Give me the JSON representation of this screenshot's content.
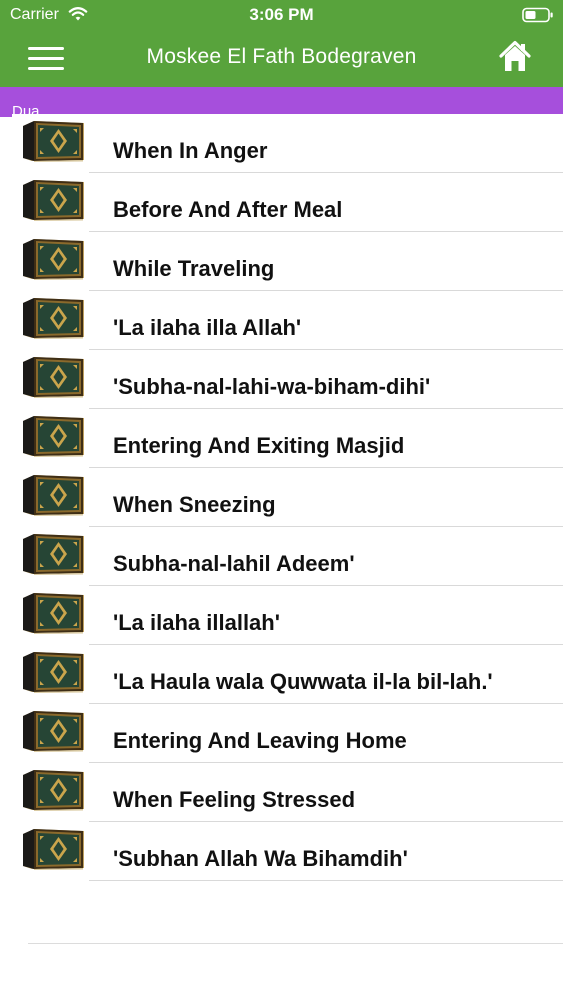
{
  "status_bar": {
    "carrier": "Carrier",
    "time": "3:06 PM"
  },
  "nav": {
    "title": "Moskee El Fath Bodegraven",
    "menu_icon": "hamburger-menu-icon",
    "home_icon": "home-icon"
  },
  "section": {
    "label": "Dua"
  },
  "colors": {
    "nav_bar": "#58a33c",
    "section_header": "#a64fdc",
    "text": "#111111"
  },
  "list": {
    "item_icon": "quran-book-icon",
    "items": [
      {
        "label": "When In Anger"
      },
      {
        "label": "Before And After Meal"
      },
      {
        "label": "While Traveling"
      },
      {
        "label": "'La ilaha illa Allah'"
      },
      {
        "label": "'Subha-nal-lahi-wa-biham-dihi'"
      },
      {
        "label": "Entering And Exiting Masjid"
      },
      {
        "label": "When Sneezing"
      },
      {
        "label": "Subha-nal-lahil Adeem'"
      },
      {
        "label": "'La ilaha illallah'"
      },
      {
        "label": "'La Haula wala Quwwata il-la bil-lah.'"
      },
      {
        "label": "Entering And Leaving Home"
      },
      {
        "label": "When Feeling Stressed"
      },
      {
        "label": "'Subhan Allah Wa Bihamdih'"
      }
    ]
  }
}
